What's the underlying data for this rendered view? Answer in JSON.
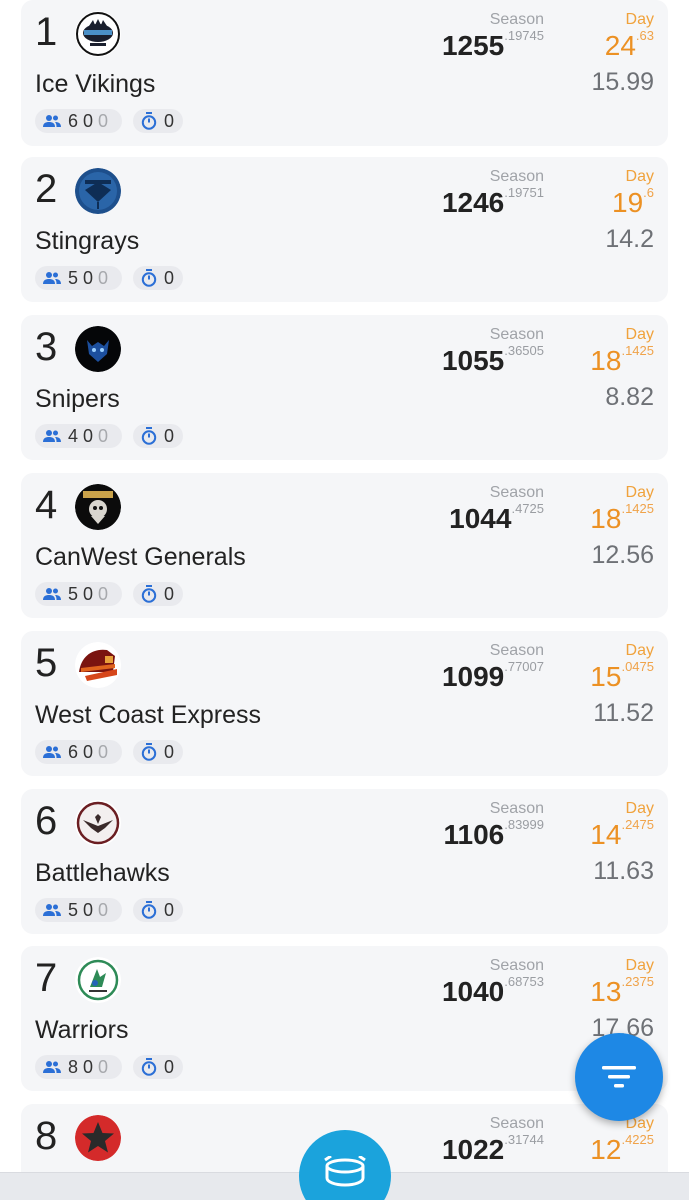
{
  "labels": {
    "season": "Season",
    "day": "Day"
  },
  "teams": [
    {
      "rank": "1",
      "name": "Ice Vikings",
      "season_int": "1255",
      "season_dec": ".19745",
      "day_int": "24",
      "day_dec": ".63",
      "total": "15.99",
      "members": "6",
      "members_zeros": "0",
      "members_tail": "0",
      "timer": "0",
      "logo": "ice-vikings-logo"
    },
    {
      "rank": "2",
      "name": "Stingrays",
      "season_int": "1246",
      "season_dec": ".19751",
      "day_int": "19",
      "day_dec": ".6",
      "total": "14.2",
      "members": "5",
      "members_zeros": "0",
      "members_tail": "0",
      "timer": "0",
      "logo": "stingrays-logo"
    },
    {
      "rank": "3",
      "name": "Snipers",
      "season_int": "1055",
      "season_dec": ".36505",
      "day_int": "18",
      "day_dec": ".1425",
      "total": "8.82",
      "members": "4",
      "members_zeros": "0",
      "members_tail": "0",
      "timer": "0",
      "logo": "snipers-logo"
    },
    {
      "rank": "4",
      "name": "CanWest Generals",
      "season_int": "1044",
      "season_dec": ".4725",
      "day_int": "18",
      "day_dec": ".1425",
      "total": "12.56",
      "members": "5",
      "members_zeros": "0",
      "members_tail": "0",
      "timer": "0",
      "logo": "generals-logo"
    },
    {
      "rank": "5",
      "name": "West Coast Express",
      "season_int": "1099",
      "season_dec": ".77007",
      "day_int": "15",
      "day_dec": ".0475",
      "total": "11.52",
      "members": "6",
      "members_zeros": "0",
      "members_tail": "0",
      "timer": "0",
      "logo": "express-logo"
    },
    {
      "rank": "6",
      "name": "Battlehawks",
      "season_int": "1106",
      "season_dec": ".83999",
      "day_int": "14",
      "day_dec": ".2475",
      "total": "11.63",
      "members": "5",
      "members_zeros": "0",
      "members_tail": "0",
      "timer": "0",
      "logo": "battlehawks-logo"
    },
    {
      "rank": "7",
      "name": "Warriors",
      "season_int": "1040",
      "season_dec": ".68753",
      "day_int": "13",
      "day_dec": ".2375",
      "total": "17.66",
      "members": "8",
      "members_zeros": "0",
      "members_tail": "0",
      "timer": "0",
      "logo": "warriors-logo"
    },
    {
      "rank": "8",
      "name": "",
      "season_int": "1022",
      "season_dec": ".31744",
      "day_int": "12",
      "day_dec": ".4225",
      "total": "",
      "members": "",
      "members_zeros": "",
      "members_tail": "",
      "timer": "",
      "logo": "star-logo"
    }
  ],
  "icons": {
    "members": "people-icon",
    "timer": "stopwatch-icon",
    "filter": "filter-icon",
    "center": "hockey-icon"
  },
  "colors": {
    "accent": "#1e88e5",
    "day": "#ec9124",
    "card": "#f5f6f8"
  }
}
